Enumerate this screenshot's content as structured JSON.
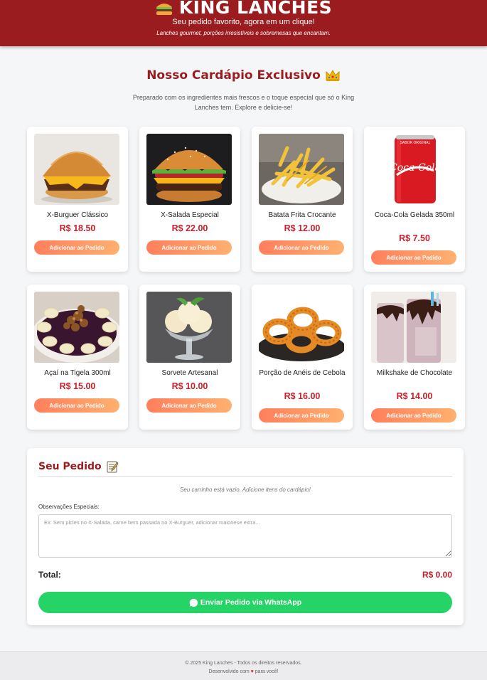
{
  "header": {
    "brand": "KING LANCHES",
    "brand_icon": "burger-icon",
    "tagline": "Seu pedido favorito, agora em um clique!",
    "sub_tagline": "Lanches gourmet, porções irresistíveis e sobremesas que encantam."
  },
  "menu": {
    "title": "Nosso Cardápio Exclusivo",
    "title_icon": "crown-icon",
    "intro": "Preparado com os ingredientes mais frescos e o toque especial que só o King Lanches tem. Explore e delicie-se!",
    "add_button_label": "Adicionar ao Pedido",
    "items": [
      {
        "name": "X-Burguer Clássico",
        "price": "R$ 18.50",
        "image": "cheeseburger-photo"
      },
      {
        "name": "X-Salada Especial",
        "price": "R$ 22.00",
        "image": "salad-burger-photo"
      },
      {
        "name": "Batata Frita Crocante",
        "price": "R$ 12.00",
        "image": "french-fries-photo"
      },
      {
        "name": "Coca-Cola Gelada 350ml",
        "price": "R$ 7.50",
        "image": "coca-cola-can-photo"
      },
      {
        "name": "Açaí na Tigela 300ml",
        "price": "R$ 15.00",
        "image": "acai-bowl-photo"
      },
      {
        "name": "Sorvete Artesanal",
        "price": "R$ 10.00",
        "image": "ice-cream-photo"
      },
      {
        "name": "Porção de Anéis de Cebola",
        "price": "R$ 16.00",
        "image": "onion-rings-photo"
      },
      {
        "name": "Milkshake de Chocolate",
        "price": "R$ 14.00",
        "image": "milkshake-photo"
      }
    ]
  },
  "order": {
    "title": "Seu Pedido",
    "title_icon": "memo-icon",
    "empty_message": "Seu carrinho está vazio. Adicione itens do cardápio!",
    "notes_label": "Observações Especiais:",
    "notes_placeholder": "Ex: Sem picles no X-Salada, carne bem passada no X-Burguer, adicionar maionese extra...",
    "notes_value": "",
    "total_label": "Total:",
    "total_value": "R$ 0.00",
    "whatsapp_button": "Enviar Pedido via WhatsApp",
    "whatsapp_icon": "whatsapp-icon"
  },
  "footer": {
    "copyright": "© 2025 King Lanches - Todos os direitos reservados.",
    "dev_prefix": "Desenvolvido com",
    "heart": "♥",
    "dev_suffix": "para você!"
  },
  "colors": {
    "brand_red": "#9b1c1f",
    "price_red": "#c8202c",
    "button_gradient_start": "#ff7f5c",
    "button_gradient_end": "#ffb070",
    "whatsapp_green": "#25d366"
  }
}
